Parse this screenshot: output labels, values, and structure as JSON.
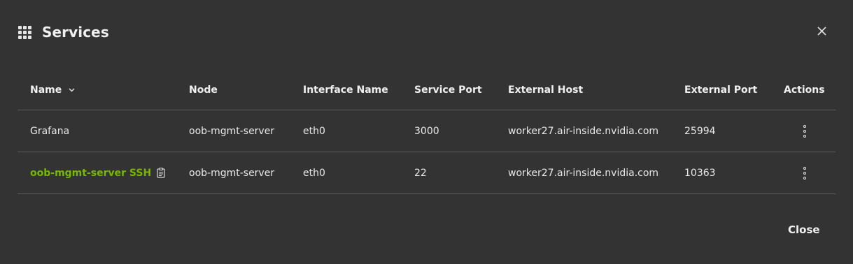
{
  "dialog": {
    "title": "Services",
    "title_icon": "grid-icon",
    "close_icon": "close-icon",
    "close_button_label": "Close"
  },
  "table": {
    "columns": {
      "name": "Name",
      "node": "Node",
      "interface": "Interface Name",
      "service_port": "Service Port",
      "external_host": "External Host",
      "external_port": "External Port",
      "actions": "Actions"
    },
    "sort_icon": "chevron-down-icon",
    "rows": [
      {
        "name": "Grafana",
        "node": "oob-mgmt-server",
        "interface": "eth0",
        "service_port": "3000",
        "external_host": "worker27.air-inside.nvidia.com",
        "external_port": "25994",
        "actions_icon": "kebab-menu-icon"
      },
      {
        "name": "oob-mgmt-server SSH",
        "name_color": "#76b900",
        "name_icon": "clipboard-icon",
        "node": "oob-mgmt-server",
        "interface": "eth0",
        "service_port": "22",
        "external_host": "worker27.air-inside.nvidia.com",
        "external_port": "10363",
        "actions_icon": "kebab-menu-icon"
      }
    ]
  },
  "colors": {
    "background": "#333333",
    "accent": "#76b900",
    "divider": "#5a5a5a",
    "text": "#e8e8e8"
  }
}
